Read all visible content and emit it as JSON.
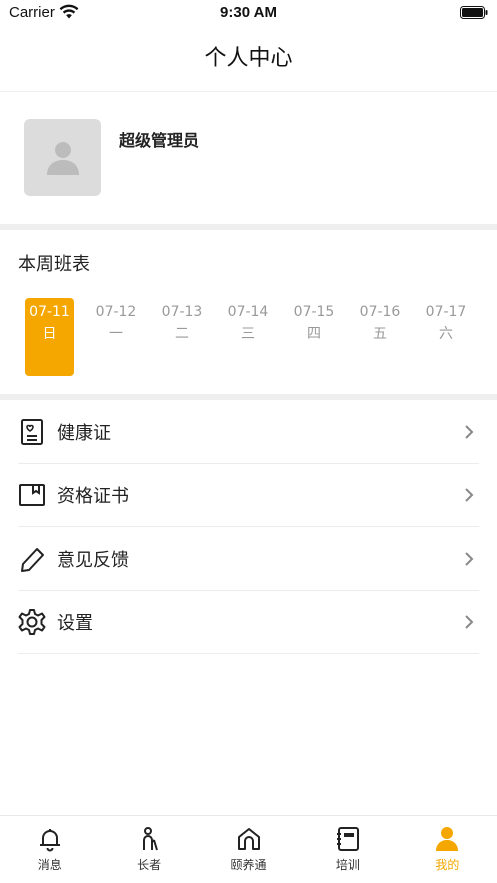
{
  "status_bar": {
    "carrier": "Carrier",
    "time": "9:30 AM"
  },
  "nav": {
    "title": "个人中心"
  },
  "profile": {
    "name": "超级管理员"
  },
  "schedule": {
    "title": "本周班表",
    "days": [
      {
        "date": "07-11",
        "weekday": "日",
        "active": true
      },
      {
        "date": "07-12",
        "weekday": "一",
        "active": false
      },
      {
        "date": "07-13",
        "weekday": "二",
        "active": false
      },
      {
        "date": "07-14",
        "weekday": "三",
        "active": false
      },
      {
        "date": "07-15",
        "weekday": "四",
        "active": false
      },
      {
        "date": "07-16",
        "weekday": "五",
        "active": false
      },
      {
        "date": "07-17",
        "weekday": "六",
        "active": false
      }
    ]
  },
  "menu": {
    "items": [
      {
        "label": "健康证",
        "icon": "health-certificate-icon"
      },
      {
        "label": "资格证书",
        "icon": "certificate-book-icon"
      },
      {
        "label": "意见反馈",
        "icon": "pencil-icon"
      },
      {
        "label": "设置",
        "icon": "gear-icon"
      }
    ]
  },
  "tabbar": {
    "items": [
      {
        "label": "消息",
        "icon": "bell-icon",
        "active": false
      },
      {
        "label": "长者",
        "icon": "elder-icon",
        "active": false
      },
      {
        "label": "颐养通",
        "icon": "home-icon",
        "active": false
      },
      {
        "label": "培训",
        "icon": "notebook-icon",
        "active": false
      },
      {
        "label": "我的",
        "icon": "user-icon",
        "active": true
      }
    ]
  },
  "colors": {
    "accent": "#f5a700",
    "divider": "#efefef",
    "muted": "#999999"
  }
}
